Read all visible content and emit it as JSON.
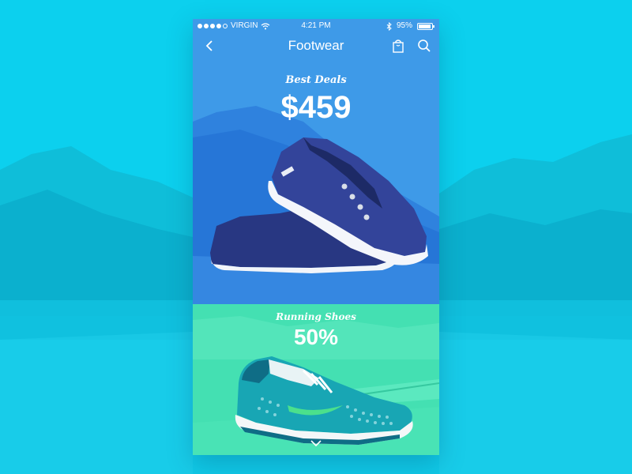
{
  "status_bar": {
    "carrier": "VIRGIN",
    "time": "4:21 PM",
    "battery": "95%",
    "battery_level": 0.95,
    "signal_bars_filled": 4,
    "signal_bars_total": 5
  },
  "nav": {
    "title": "Footwear",
    "back_icon": "chevron-left-icon",
    "bag_icon": "shopping-bag-icon",
    "search_icon": "search-icon"
  },
  "deals": {
    "label": "Best Deals",
    "price": "$459"
  },
  "running": {
    "label": "Running Shoes",
    "discount": "50%"
  },
  "colors": {
    "background": "#0cd0ee",
    "top_panel": "#3e9ae8",
    "bottom_panel": "#44e0b2",
    "sneaker_navy": "#2f3f8c",
    "running_shoe_teal": "#18a6b4",
    "swoosh": "#4be08c"
  }
}
